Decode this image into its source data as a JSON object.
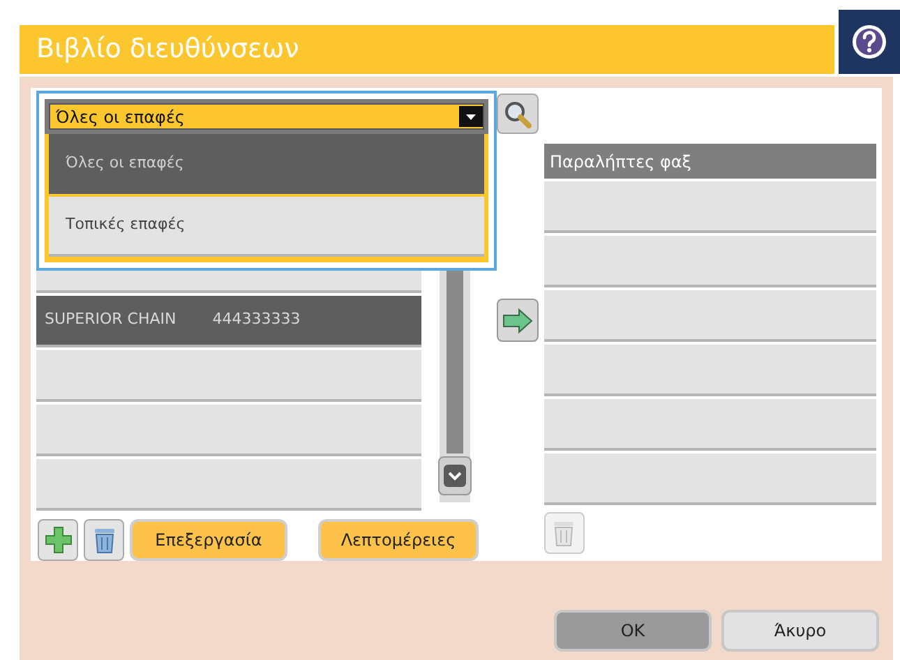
{
  "header": {
    "title": "Βιβλίο διευθύνσεων"
  },
  "contact_filter": {
    "value": "Όλες οι επαφές",
    "expanded": true,
    "options": [
      {
        "label": "Όλες οι επαφές",
        "selected": true
      },
      {
        "label": "Τοπικές επαφές",
        "selected": false
      }
    ]
  },
  "contacts": [
    {
      "name": "SUPERIOR CHAIN",
      "number": "444333333",
      "selected": true
    }
  ],
  "recipients": {
    "header": "Παραλήπτες φαξ"
  },
  "actions": {
    "edit": "Επεξεργασία",
    "details": "Λεπτομέρειες"
  },
  "dialog_buttons": [
    {
      "label": "OK",
      "kind": "primary"
    },
    {
      "label": "Άκυρο",
      "kind": "secondary"
    }
  ]
}
